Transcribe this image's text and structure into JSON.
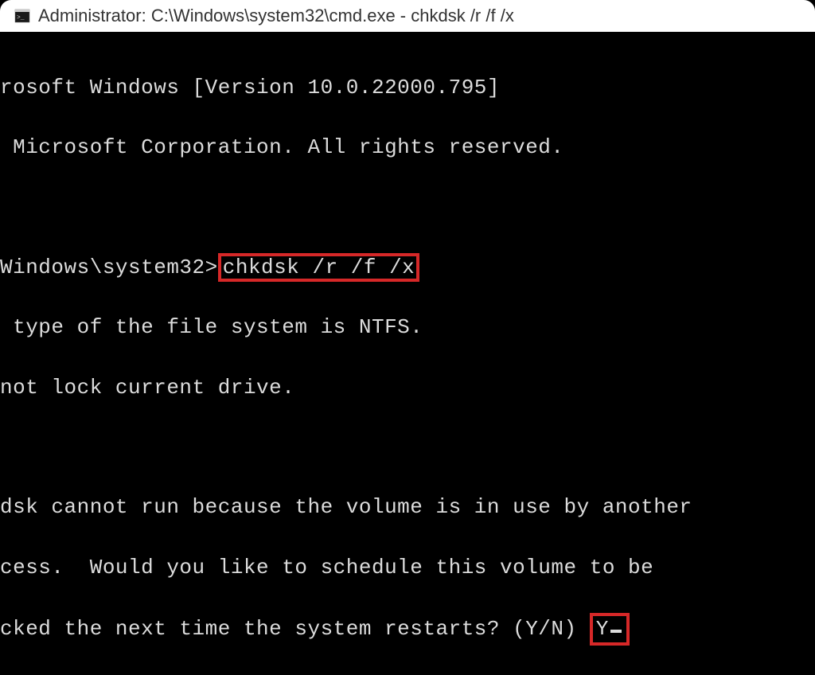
{
  "titlebar": {
    "text": "Administrator: C:\\Windows\\system32\\cmd.exe - chkdsk  /r /f /x"
  },
  "terminal": {
    "line1": "rosoft Windows [Version 10.0.22000.795]",
    "line2": " Microsoft Corporation. All rights reserved.",
    "prompt_prefix": "Windows\\system32>",
    "command": "chkdsk /r /f /x",
    "line4": " type of the file system is NTFS.",
    "line5": "not lock current drive.",
    "line6": "dsk cannot run because the volume is in use by another",
    "line7": "cess.  Would you like to schedule this volume to be",
    "line8_prefix": "cked the next time the system restarts? (Y/N) ",
    "user_input": "Y"
  }
}
